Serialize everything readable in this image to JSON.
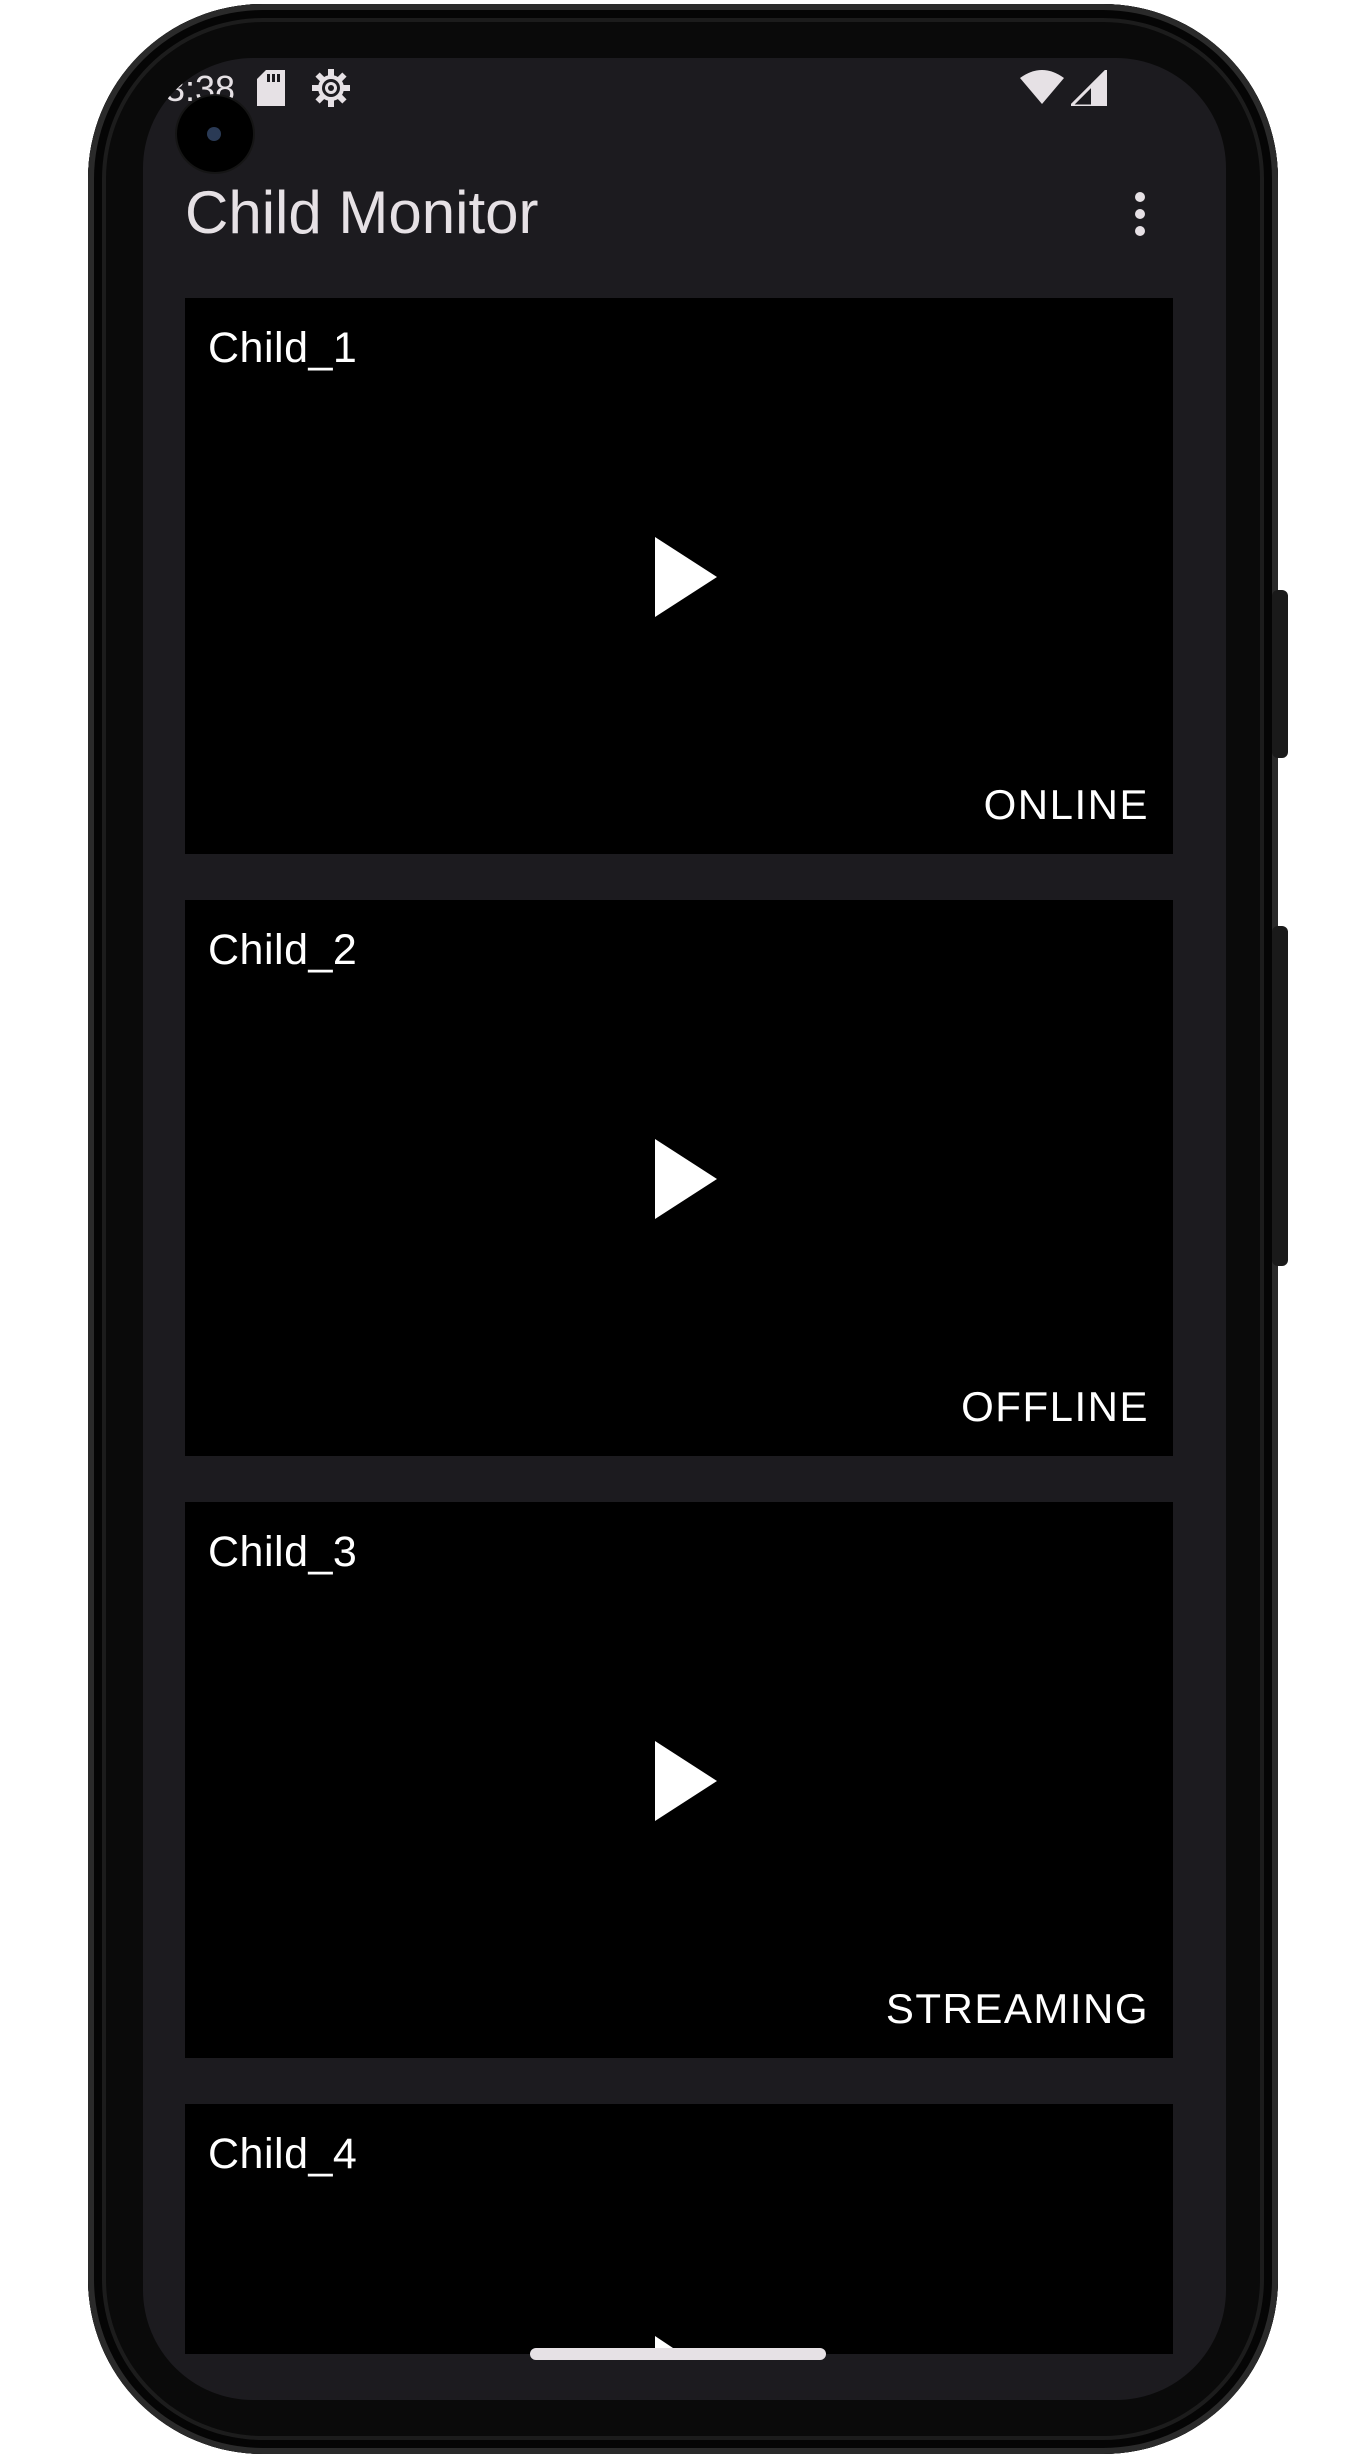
{
  "status_bar": {
    "time": "3:38",
    "icons": [
      "sd-card-icon",
      "settings-gear-icon",
      "wifi-icon",
      "cellular-signal-icon"
    ]
  },
  "app_bar": {
    "title": "Child Monitor",
    "menu_icon": "more-vert-icon"
  },
  "children": [
    {
      "name": "Child_1",
      "status": "ONLINE"
    },
    {
      "name": "Child_2",
      "status": "OFFLINE"
    },
    {
      "name": "Child_3",
      "status": "STREAMING"
    },
    {
      "name": "Child_4",
      "status": ""
    }
  ],
  "colors": {
    "background": "#1c1b1f",
    "card": "#000000",
    "text": "#ffffff"
  }
}
